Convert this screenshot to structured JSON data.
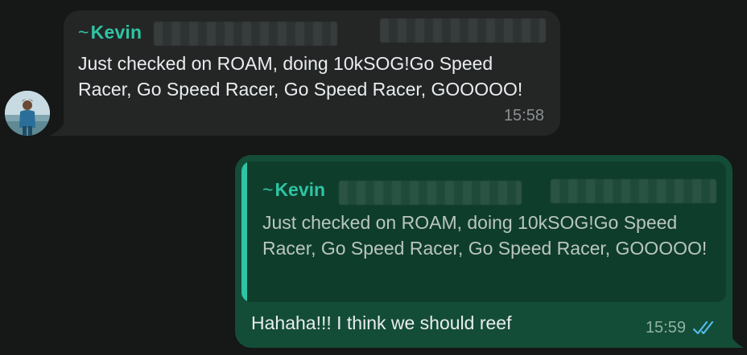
{
  "incoming": {
    "sender_prefix": "~",
    "sender_name": "Kevin",
    "text": "Just checked on ROAM, doing 10kSOG!Go Speed Racer, Go Speed Racer, Go Speed Racer, GOOOOO!",
    "time": "15:58"
  },
  "outgoing": {
    "quoted_sender_prefix": "~",
    "quoted_sender_name": "Kevin",
    "quoted_text": "Just checked on ROAM, doing 10kSOG!Go Speed Racer, Go Speed Racer, Go Speed Racer, GOOOOO!",
    "text": "Hahaha!!!  I think we should reef",
    "time": "15:59",
    "status_icon": "double-check-read-icon"
  },
  "colors": {
    "background": "#161717",
    "incoming_bubble": "#242626",
    "outgoing_bubble": "#144d37",
    "quote_background": "#0f3d2b",
    "sender_accent": "#2ec4a4",
    "read_ticks": "#53bdeb"
  }
}
